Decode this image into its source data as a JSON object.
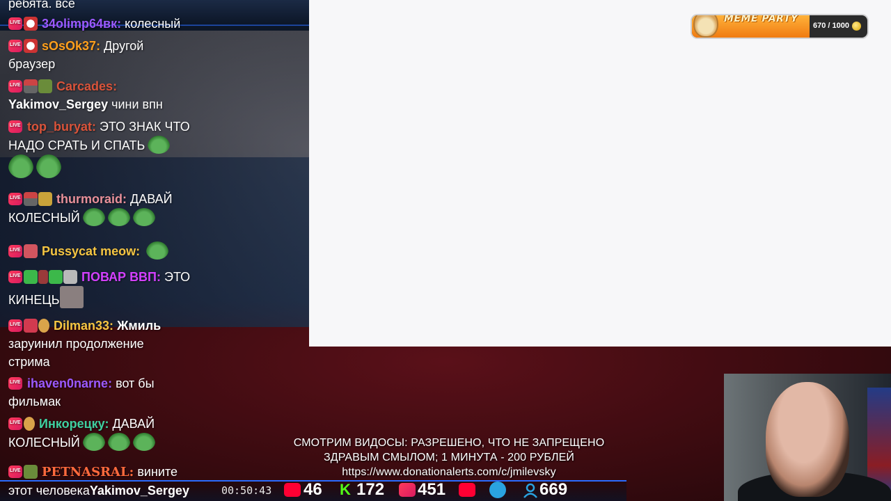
{
  "meme_party": {
    "title": "MEME PARTY",
    "count": "670 / 1000",
    "progress": 0.67
  },
  "chat": {
    "top_partial": "ребята. все",
    "messages": [
      {
        "user": "34olimp64вк:",
        "user_color": "#9b59ff",
        "text": "колесный"
      },
      {
        "user": "sOsOk37:",
        "user_color": "#ff9f1c",
        "text": "Другой",
        "text2": "браузер"
      },
      {
        "user": "Carcades:",
        "user_color": "#d9533a",
        "text": "",
        "text2": "Yakimov_Sergey",
        "text3": "чини впн"
      },
      {
        "user": "top_buryat:",
        "user_color": "#d9533a",
        "text": "ЭТО ЗНАК ЧТО",
        "text2": "НАДО СРАТЬ И СПАТЬ"
      },
      {
        "user": "thurmoraid:",
        "user_color": "#e8909a",
        "text": "ДАВАЙ",
        "text2": "КОЛЕСНЫЙ"
      },
      {
        "user": "Pussycat meow:",
        "user_color": "#f5c542",
        "text": ""
      },
      {
        "user": "ПОВАР ВВП:",
        "user_color": "#d340ff",
        "text": "ЭТО",
        "text2": "КИНЕЦЬ"
      },
      {
        "user": "Dilman33:",
        "user_color": "#f5c542",
        "text": "Жмиль",
        "text2": "заруинил продолжение",
        "text3": "стрима"
      },
      {
        "user": "ihaven0narne:",
        "user_color": "#9b59ff",
        "text": "вот бы",
        "text2": "фильмак"
      },
      {
        "user": "Инкорецку:",
        "user_color": "#3fd0a0",
        "text": "ДАВАЙ",
        "text2": "КОЛЕСНЫЙ"
      },
      {
        "user": "PETNASRAL:",
        "user_color": "#ff6a3d",
        "text": "вините",
        "text2": "этот человека",
        "text3": "Yakimov_Sergey"
      }
    ]
  },
  "overlay": {
    "line1": "СМОТРИМ ВИДОСЫ: РАЗРЕШЕНО, ЧТО НЕ ЗАПРЕЩЕНО",
    "line2": "ЗДРАВЫМ СМЫЛОМ; 1 МИНУТА - 200 РУБЛЕЙ",
    "line3": "https://www.donationalerts.com/c/jmilevsky"
  },
  "stats": {
    "timer": "00:50:43",
    "youtube": "46",
    "kick": "172",
    "vk_live": "451",
    "viewers": "669"
  },
  "colors": {
    "accent_blue": "#2a6cff",
    "youtube_red": "#ff0033",
    "kick_green": "#53fc18",
    "telegram_blue": "#2aa3e0"
  }
}
